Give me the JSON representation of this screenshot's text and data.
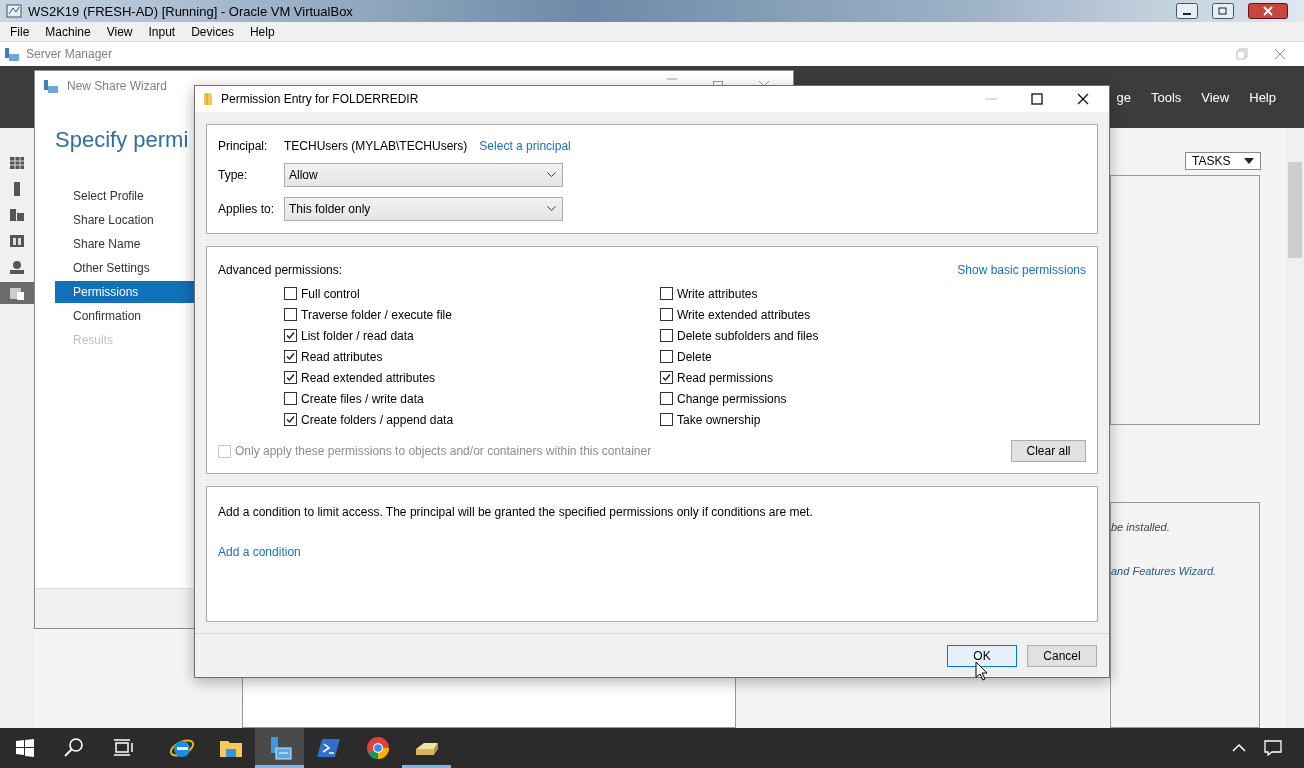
{
  "vm_window": {
    "title": "WS2K19 (FRESH-AD) [Running] - Oracle VM VirtualBox",
    "menu": [
      "File",
      "Machine",
      "View",
      "Input",
      "Devices",
      "Help"
    ]
  },
  "server_manager": {
    "title": "Server Manager",
    "menu": [
      "ge",
      "Tools",
      "View",
      "Help"
    ],
    "tasks_button": "TASKS",
    "notes": [
      {
        "text": "be installed.",
        "kind": "plain"
      },
      {
        "text": "and Features Wizard.",
        "kind": "link"
      }
    ],
    "nav": [
      {
        "selected": false
      },
      {
        "selected": false
      },
      {
        "selected": false
      },
      {
        "selected": false
      },
      {
        "selected": false
      },
      {
        "selected": true
      }
    ]
  },
  "wizard": {
    "title": "New Share Wizard",
    "heading": "Specify permi",
    "steps": [
      {
        "label": "Select Profile",
        "selected": false,
        "disabled": false
      },
      {
        "label": "Share Location",
        "selected": false,
        "disabled": false
      },
      {
        "label": "Share Name",
        "selected": false,
        "disabled": false
      },
      {
        "label": "Other Settings",
        "selected": false,
        "disabled": false
      },
      {
        "label": "Permissions",
        "selected": true,
        "disabled": false
      },
      {
        "label": "Confirmation",
        "selected": false,
        "disabled": false
      },
      {
        "label": "Results",
        "selected": false,
        "disabled": true
      }
    ]
  },
  "dialog": {
    "title": "Permission Entry for FOLDERREDIR",
    "principal_label": "Principal:",
    "principal": "TECHUsers (MYLAB\\TECHUsers)",
    "select_principal": "Select a principal",
    "type_label": "Type:",
    "type": "Allow",
    "applies_label": "Applies to:",
    "applies": "This folder only",
    "advanced_label": "Advanced permissions:",
    "show_basic": "Show basic permissions",
    "permissions": [
      {
        "label": "Full control",
        "checked": false
      },
      {
        "label": "Traverse folder / execute file",
        "checked": false
      },
      {
        "label": "List folder / read data",
        "checked": true
      },
      {
        "label": "Read attributes",
        "checked": true
      },
      {
        "label": "Read extended attributes",
        "checked": true
      },
      {
        "label": "Create files / write data",
        "checked": false
      },
      {
        "label": "Create folders / append data",
        "checked": true
      },
      {
        "label": "Write attributes",
        "checked": false
      },
      {
        "label": "Write extended attributes",
        "checked": false
      },
      {
        "label": "Delete subfolders and files",
        "checked": false
      },
      {
        "label": "Delete",
        "checked": false
      },
      {
        "label": "Read permissions",
        "checked": true
      },
      {
        "label": "Change permissions",
        "checked": false
      },
      {
        "label": "Take ownership",
        "checked": false
      }
    ],
    "only_apply": {
      "label": "Only apply these permissions to objects and/or containers within this container",
      "checked": false,
      "disabled": true
    },
    "clear_all": "Clear all",
    "condition_text": "Add a condition to limit access. The principal will be granted the specified permissions only if conditions are met.",
    "add_condition": "Add a condition",
    "buttons": [
      {
        "label": "OK",
        "selected": true
      },
      {
        "label": "Cancel",
        "selected": false
      }
    ]
  },
  "taskbar": {
    "apps": [
      {
        "kind": "start",
        "selected": false,
        "running": false
      },
      {
        "kind": "search",
        "selected": false,
        "running": false
      },
      {
        "kind": "taskview",
        "selected": false,
        "running": false
      },
      {
        "kind": "ie",
        "selected": false,
        "running": false
      },
      {
        "kind": "explorer",
        "selected": false,
        "running": false
      },
      {
        "kind": "servermanager",
        "selected": true,
        "running": true
      },
      {
        "kind": "powershell",
        "selected": false,
        "running": false
      },
      {
        "kind": "chrome",
        "selected": false,
        "running": false
      },
      {
        "kind": "drive",
        "selected": false,
        "running": true
      }
    ]
  }
}
